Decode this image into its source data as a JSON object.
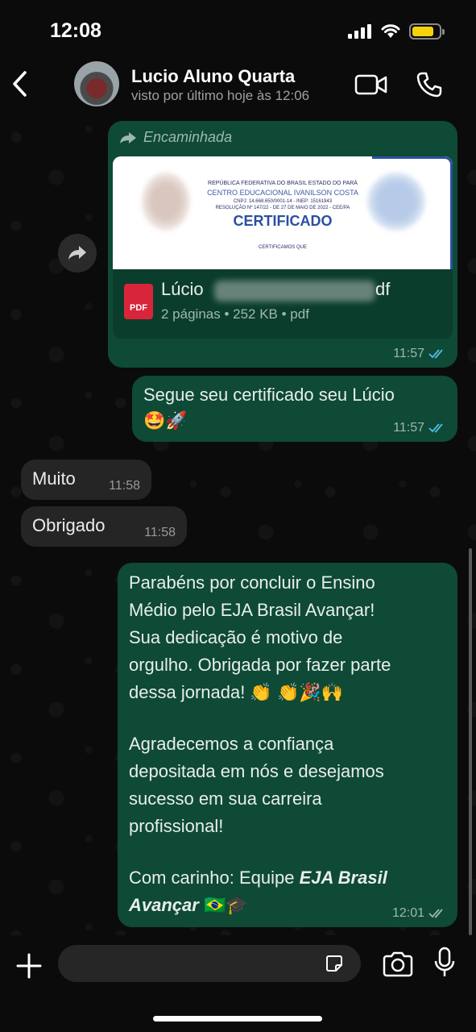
{
  "status_bar": {
    "time": "12:08"
  },
  "header": {
    "contact_name": "Lucio Aluno Quarta",
    "last_seen": "visto por último hoje às 12:06"
  },
  "messages": {
    "forwarded_doc": {
      "forward_label": "Encaminhada",
      "preview": {
        "line1": "REPÚBLICA FEDERATIVA DO BRASIL ESTADO DO PARÁ",
        "line2": "CENTRO EDUCACIONAL IVANILSON COSTA",
        "line3": "CNPJ: 14.668.650/0001-14 - INEP: 15161943",
        "line4": "RESOLUÇÃO Nº 147/22 - DE 27 DE MAIO DE 2022 - CEE/PA",
        "title": "CERTIFICADO",
        "line5": "CERTIFICAMOS QUE"
      },
      "pdf_icon_label": "PDF",
      "file_name_start": "Lúcio",
      "file_name_end": "df",
      "file_info": "2 páginas • 252 KB • pdf",
      "time": "11:57"
    },
    "certificate_text": {
      "text": "Segue seu certificado seu Lúcio",
      "emojis": "🤩🚀",
      "time": "11:57"
    },
    "muito": {
      "text": "Muito",
      "time": "11:58"
    },
    "obrigado": {
      "text": "Obrigado",
      "time": "11:58"
    },
    "congrats": {
      "para1": "Parabéns por concluir o Ensino\nMédio pelo EJA Brasil Avançar!\nSua dedicação é motivo de\norgulho. Obrigada por fazer parte\ndessa jornada! 👏 👏🎉🙌",
      "para2": "Agradecemos a confiança\ndepositada em nós e desejamos\nsucesso em sua carreira\nprofissional!",
      "signature_prefix": "Com carinho: Equipe ",
      "signature_bold_1": "EJA Brasil",
      "signature_bold_2": "Avançar",
      "signature_emojis": "🇧🇷🎓",
      "time": "12:01"
    }
  },
  "colors": {
    "outgoing_bubble": "#0e4a35",
    "incoming_bubble": "#252525",
    "read_tick": "#53bdeb",
    "pdf_red": "#d9253b"
  },
  "icons": [
    "back-icon",
    "video-call-icon",
    "phone-icon",
    "forward-icon",
    "plus-icon",
    "sticker-icon",
    "camera-icon",
    "mic-icon"
  ]
}
